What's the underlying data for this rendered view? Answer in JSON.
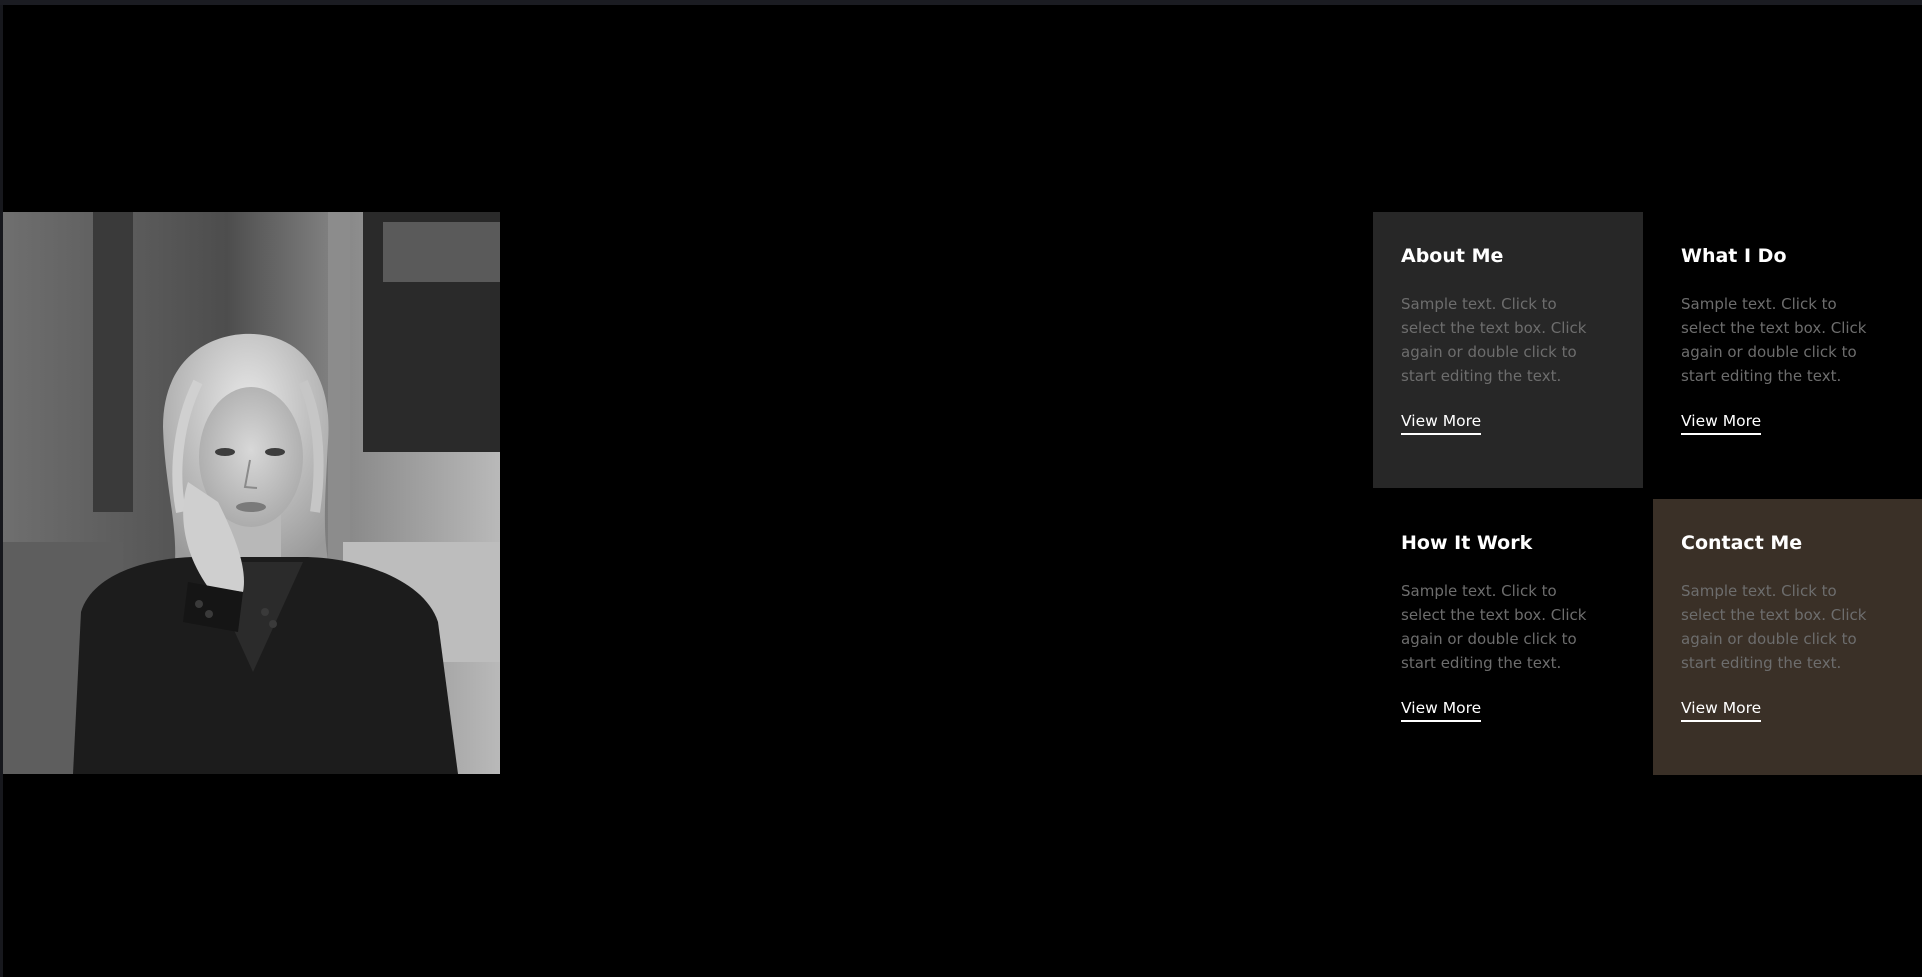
{
  "photo": {
    "alt": "",
    "tone": "grayscale"
  },
  "cards": [
    {
      "title": "About Me",
      "text": "Sample text. Click to select the text box. Click again or double click to start editing the text.",
      "link": "View More",
      "background": "#272727"
    },
    {
      "title": "What I Do",
      "text": "Sample text. Click to select the text box. Click again or double click to start editing the text.",
      "link": "View More",
      "background": "#000000"
    },
    {
      "title": "How It Work",
      "text": "Sample text. Click to select the text box. Click again or double click to start editing the text.",
      "link": "View More",
      "background": "#000000"
    },
    {
      "title": "Contact Me",
      "text": "Sample text. Click to select the text box. Click again or double click to start editing the text.",
      "link": "View More",
      "background": "#3a3027"
    }
  ],
  "colors": {
    "page_background": "#000000",
    "title": "#ffffff",
    "body_text": "#6d6d6d",
    "link": "#ffffff"
  }
}
